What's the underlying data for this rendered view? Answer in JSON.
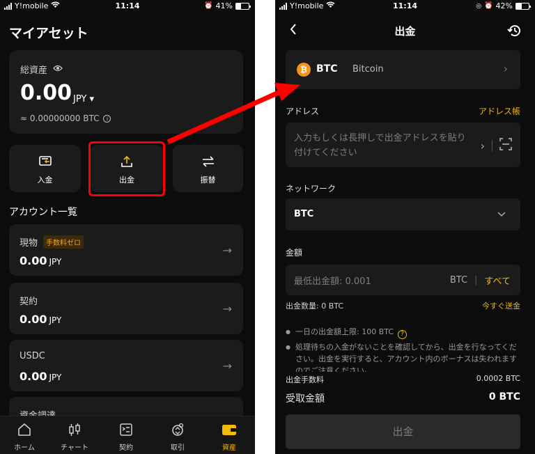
{
  "left": {
    "status": {
      "carrier": "Y!mobile",
      "time": "11:14",
      "battery": "41%",
      "battery_level": 0.41
    },
    "title": "マイアセット",
    "asset": {
      "label": "総資産",
      "value": "0.00",
      "currency": "JPY ▾",
      "btc": "≈ 0.00000000 BTC"
    },
    "actions": [
      {
        "label": "入金",
        "icon": "deposit-card-icon"
      },
      {
        "label": "出金",
        "icon": "withdraw-upload-icon"
      },
      {
        "label": "振替",
        "icon": "transfer-arrows-icon"
      }
    ],
    "section_title": "アカウント一覧",
    "accounts": [
      {
        "name": "現物",
        "badge": "手数料ゼロ",
        "value": "0.00",
        "currency": "JPY"
      },
      {
        "name": "契約",
        "badge": "",
        "value": "0.00",
        "currency": "JPY"
      },
      {
        "name": "USDC",
        "badge": "",
        "value": "0.00",
        "currency": "JPY"
      },
      {
        "name": "資金調達",
        "badge": "",
        "value": "",
        "currency": ""
      }
    ],
    "nav": [
      {
        "label": "ホーム",
        "icon": "home-icon"
      },
      {
        "label": "チャート",
        "icon": "candlestick-icon"
      },
      {
        "label": "契約",
        "icon": "contract-doc-icon"
      },
      {
        "label": "取引",
        "icon": "trade-icon"
      },
      {
        "label": "資産",
        "icon": "wallet-icon",
        "active": true
      }
    ]
  },
  "right": {
    "status": {
      "carrier": "Y!mobile",
      "time": "11:14",
      "battery": "42%",
      "battery_level": 0.42
    },
    "title": "出金",
    "coin": {
      "symbol": "BTC",
      "name": "Bitcoin",
      "icon_char": "₿"
    },
    "address": {
      "label": "アドレス",
      "book_link": "アドレス帳",
      "placeholder": "入力もしくは長押しで出金アドレスを貼り付けてください"
    },
    "network": {
      "label": "ネットワーク",
      "value": "BTC"
    },
    "amount": {
      "label": "金額",
      "placeholder": "最低出金額: 0.001",
      "currency": "BTC",
      "sep": "|",
      "all": "すべて"
    },
    "quantity": {
      "label": "出金数量: 0 BTC",
      "link": "今すぐ送金"
    },
    "notes": [
      "一日の出金額上限: 100 BTC",
      "処理待ちの入金がないことを確認してから、出金を行なってください。出金を実行すると、アカウント内のボーナスは失われますのでご注意ください。"
    ],
    "fee": {
      "label": "出金手数料",
      "value": "0.0002 BTC"
    },
    "receive": {
      "label": "受取金額",
      "value": "0 BTC"
    },
    "submit": "出金"
  },
  "colors": {
    "accent": "#f0b90b",
    "highlight": "#ff0000",
    "bg": "#0c0c0c",
    "card": "#1b1b1b"
  }
}
